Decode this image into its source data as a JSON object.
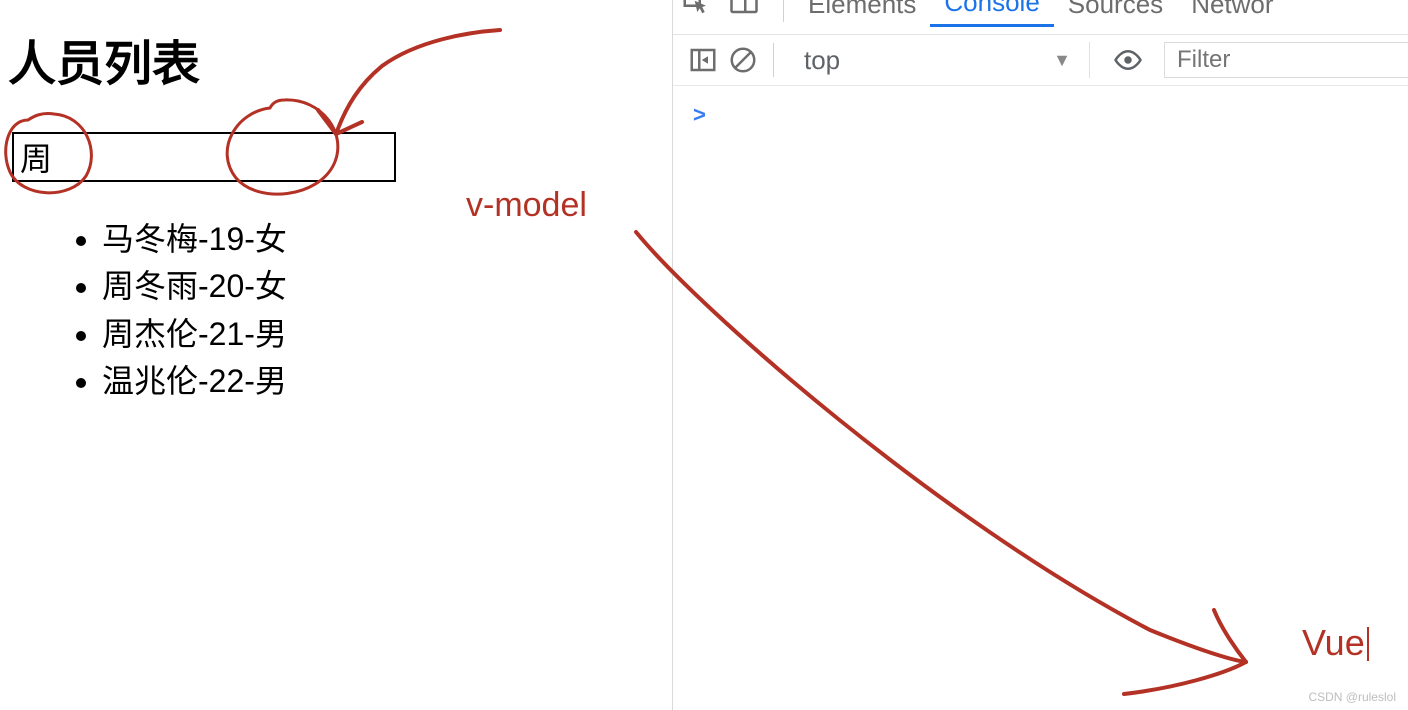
{
  "page": {
    "title": "人员列表",
    "filter_value": "周",
    "persons": [
      "马冬梅-19-女",
      "周冬雨-20-女",
      "周杰伦-21-男",
      "温兆伦-22-男"
    ]
  },
  "devtools": {
    "tabs": {
      "elements": "Elements",
      "console": "Console",
      "sources": "Sources",
      "network": "Networ"
    },
    "active_tab": "console",
    "toolbar": {
      "context_label": "top",
      "filter_placeholder": "Filter"
    },
    "prompt": ">"
  },
  "annotations": {
    "vmodel": "v-model",
    "vue": "Vue",
    "ink_color": "#b33225"
  },
  "watermark": "CSDN @ruleslol"
}
